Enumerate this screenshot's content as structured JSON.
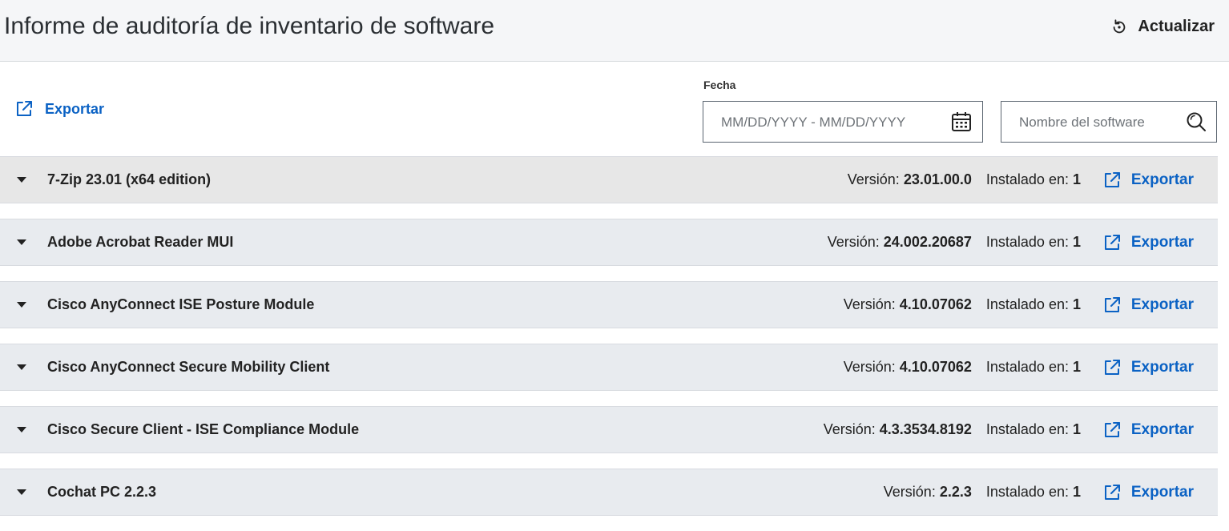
{
  "header": {
    "title": "Informe de auditoría de inventario de software",
    "refresh_label": "Actualizar"
  },
  "toolbar": {
    "export_label": "Exportar",
    "date_label": "Fecha",
    "date_placeholder": "MM/DD/YYYY - MM/DD/YYYY",
    "search_placeholder": "Nombre del software"
  },
  "labels": {
    "version": "Versión:",
    "installed_on": "Instalado en:",
    "export": "Exportar"
  },
  "software": [
    {
      "name": "7-Zip 23.01 (x64 edition)",
      "version": "23.01.00.0",
      "installed": "1"
    },
    {
      "name": "Adobe Acrobat Reader MUI",
      "version": "24.002.20687",
      "installed": "1"
    },
    {
      "name": "Cisco AnyConnect ISE Posture Module",
      "version": "4.10.07062",
      "installed": "1"
    },
    {
      "name": "Cisco AnyConnect Secure Mobility Client",
      "version": "4.10.07062",
      "installed": "1"
    },
    {
      "name": "Cisco Secure Client - ISE Compliance Module",
      "version": "4.3.3534.8192",
      "installed": "1"
    },
    {
      "name": "Cochat PC 2.2.3",
      "version": "2.2.3",
      "installed": "1"
    }
  ],
  "colors": {
    "accent": "#0b62c4",
    "header_bg": "#f5f6f8",
    "row_bg": "#e8ebef"
  },
  "icons": {
    "refresh": "refresh-icon",
    "export": "external-link-icon",
    "calendar": "calendar-icon",
    "search": "search-icon",
    "expand": "caret-down-icon"
  }
}
